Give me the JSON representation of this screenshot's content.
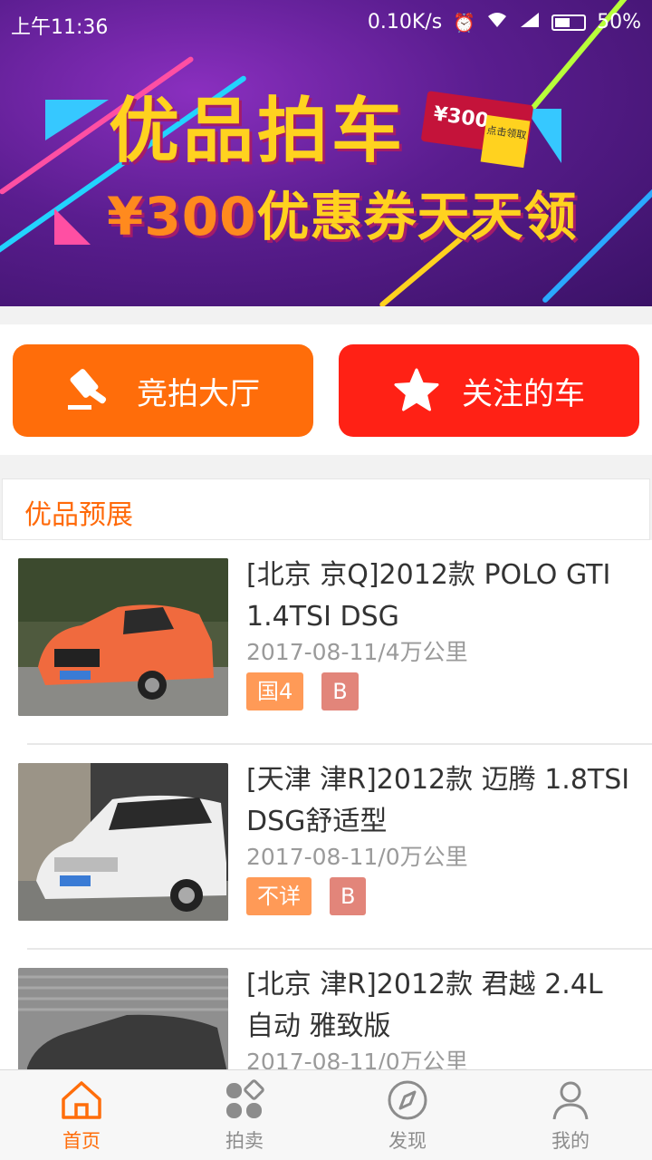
{
  "status_bar": {
    "time": "上午11:36",
    "speed": "0.10K/s",
    "battery": "50%"
  },
  "banner": {
    "title": "优品拍车",
    "subtitle_prefix": "¥300",
    "subtitle_suffix": "优惠券天天领",
    "coupon_amount": "¥300",
    "coupon_tag": "点击领取"
  },
  "quick_actions": {
    "auction_label": "竞拍大厅",
    "favorite_label": "关注的车"
  },
  "section": {
    "title": "优品预展"
  },
  "listings": [
    {
      "title": "[北京 京Q]2012款 POLO GTI 1.4TSI DSG",
      "meta": "2017-08-11/4万公里",
      "emission": "国4",
      "grade": "B"
    },
    {
      "title": "[天津 津R]2012款 迈腾 1.8TSI DSG舒适型",
      "meta": "2017-08-11/0万公里",
      "emission": "不详",
      "grade": "B"
    },
    {
      "title": "[北京 津R]2012款 君越 2.4L 自动 雅致版",
      "meta": "2017-08-11/0万公里",
      "emission": "",
      "grade": ""
    }
  ],
  "tabbar": {
    "home": "首页",
    "auction": "拍卖",
    "discover": "发现",
    "mine": "我的"
  },
  "colors": {
    "accent_orange": "#ff6d0a",
    "accent_red": "#ff2115",
    "banner_purple": "#5a1d8f"
  }
}
